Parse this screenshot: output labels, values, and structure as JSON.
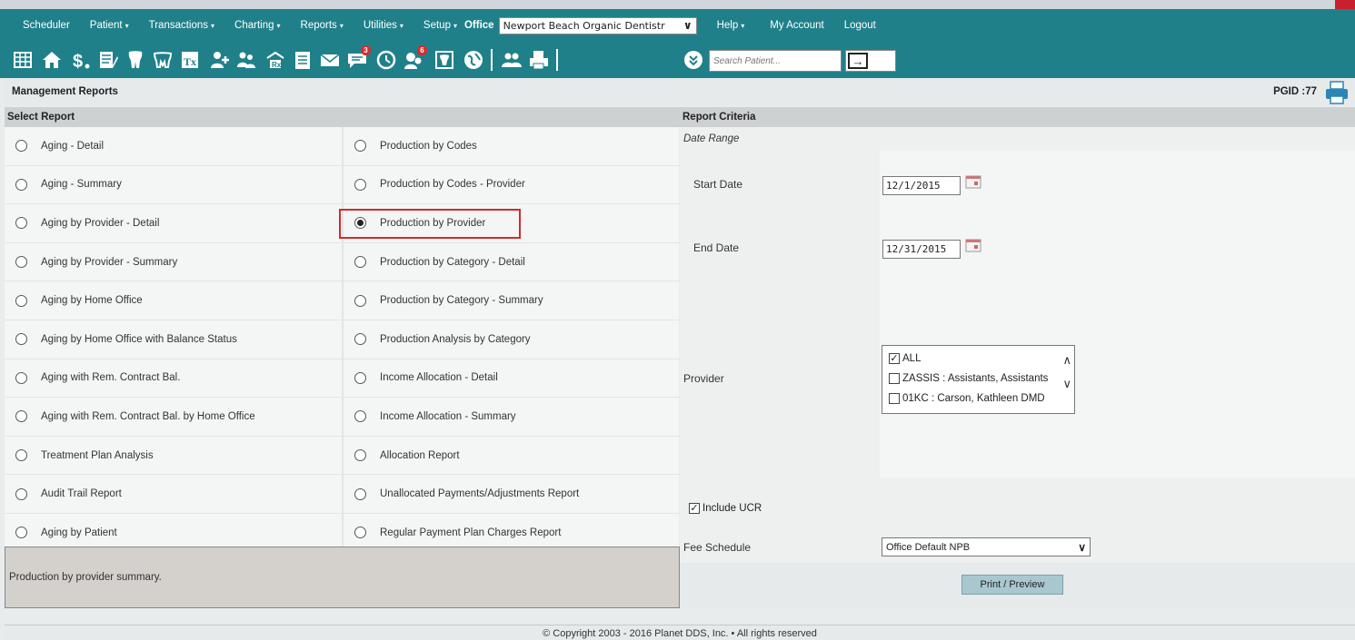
{
  "menu": {
    "items": [
      {
        "label": "Scheduler",
        "caret": ""
      },
      {
        "label": "Patient",
        "caret": "▾"
      },
      {
        "label": "Transactions",
        "caret": "▾"
      },
      {
        "label": "Charting",
        "caret": "▾"
      },
      {
        "label": "Reports",
        "caret": "▾"
      },
      {
        "label": "Utilities",
        "caret": "▾"
      },
      {
        "label": "Setup",
        "caret": "▾"
      }
    ],
    "office_label": "Office",
    "office_value": "Newport Beach Organic Dentistr",
    "help_label": "Help",
    "my_account_label": "My Account",
    "logout_label": "Logout"
  },
  "toolbar": {
    "icons": [
      "calendar-grid-icon",
      "home-icon",
      "dollar-icon",
      "ledger-icon",
      "tooth-icon",
      "teeth-icon",
      "treatment-tx-icon",
      "add-patient-icon",
      "family-icon",
      "pharmacy-rx-icon",
      "notes-icon",
      "mail-icon",
      "message-icon",
      "clock-icon",
      "patient-alert-icon",
      "tooth-chart-icon",
      "globe-icon",
      "group-icon",
      "print-station-icon"
    ],
    "message_badge": "3",
    "alert_badge": "6",
    "search_placeholder": "Search Patient..."
  },
  "page": {
    "title": "Management Reports",
    "pgid": "PGID :77"
  },
  "select_report": {
    "heading": "Select Report",
    "left_column": [
      "Aging - Detail",
      "Aging - Summary",
      "Aging by Provider - Detail",
      "Aging by Provider - Summary",
      "Aging by Home Office",
      "Aging by Home Office with Balance Status",
      "Aging with Rem. Contract Bal.",
      "Aging with Rem. Contract Bal. by Home Office",
      "Treatment Plan Analysis",
      "Audit Trail Report",
      "Aging by Patient"
    ],
    "right_column": [
      "Production by Codes",
      "Production by Codes - Provider",
      "Production by Provider",
      "Production by Category - Detail",
      "Production by Category - Summary",
      "Production Analysis by Category",
      "Income Allocation - Detail",
      "Income Allocation - Summary",
      "Allocation Report",
      "Unallocated Payments/Adjustments Report",
      "Regular Payment Plan Charges Report"
    ],
    "selected": "Production by Provider",
    "description": "Production by provider summary."
  },
  "criteria": {
    "heading": "Report Criteria",
    "date_range_label": "Date Range",
    "start_date_label": "Start Date",
    "start_date_value": "12/1/2015",
    "end_date_label": "End Date",
    "end_date_value": "12/31/2015",
    "provider_label": "Provider",
    "providers": [
      {
        "label": "ALL",
        "checked": true
      },
      {
        "label": "ZASSIS : Assistants, Assistants",
        "checked": false
      },
      {
        "label": "01KC : Carson, Kathleen DMD",
        "checked": false
      }
    ],
    "include_ucr_label": "Include UCR",
    "include_ucr_checked": true,
    "fee_schedule_label": "Fee Schedule",
    "fee_schedule_value": "Office Default NPB",
    "print_button_label": "Print / Preview"
  },
  "footer": {
    "copyright": "© Copyright 2003 - 2016 Planet DDS, Inc. • All rights reserved"
  }
}
